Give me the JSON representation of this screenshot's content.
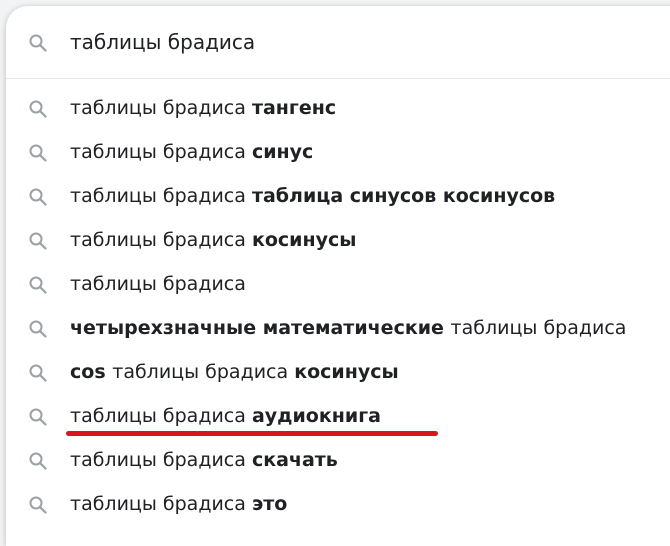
{
  "search": {
    "query": "таблицы брадиса"
  },
  "suggestions": [
    {
      "parts": [
        {
          "t": "таблицы брадиса ",
          "b": false
        },
        {
          "t": "тангенс",
          "b": true
        }
      ]
    },
    {
      "parts": [
        {
          "t": "таблицы брадиса ",
          "b": false
        },
        {
          "t": "синус",
          "b": true
        }
      ]
    },
    {
      "parts": [
        {
          "t": "таблицы брадиса ",
          "b": false
        },
        {
          "t": "таблица синусов косинусов",
          "b": true
        }
      ]
    },
    {
      "parts": [
        {
          "t": "таблицы брадиса ",
          "b": false
        },
        {
          "t": "косинусы",
          "b": true
        }
      ]
    },
    {
      "parts": [
        {
          "t": "таблицы брадиса",
          "b": false
        }
      ]
    },
    {
      "parts": [
        {
          "t": "четырехзначные математические ",
          "b": true
        },
        {
          "t": "таблицы брадиса",
          "b": false
        }
      ]
    },
    {
      "parts": [
        {
          "t": "cos ",
          "b": true
        },
        {
          "t": "таблицы брадиса ",
          "b": false
        },
        {
          "t": "косинусы",
          "b": true
        }
      ]
    },
    {
      "parts": [
        {
          "t": "таблицы брадиса ",
          "b": false
        },
        {
          "t": "аудиокнига",
          "b": true
        }
      ],
      "underlined": true
    },
    {
      "parts": [
        {
          "t": "таблицы брадиса ",
          "b": false
        },
        {
          "t": "скачать",
          "b": true
        }
      ]
    },
    {
      "parts": [
        {
          "t": "таблицы брадиса ",
          "b": false
        },
        {
          "t": "это",
          "b": true
        }
      ]
    }
  ],
  "icons": {
    "search": "search-icon"
  },
  "colors": {
    "icon": "#9aa0a6",
    "text": "#202124",
    "underline": "#d9141f"
  }
}
